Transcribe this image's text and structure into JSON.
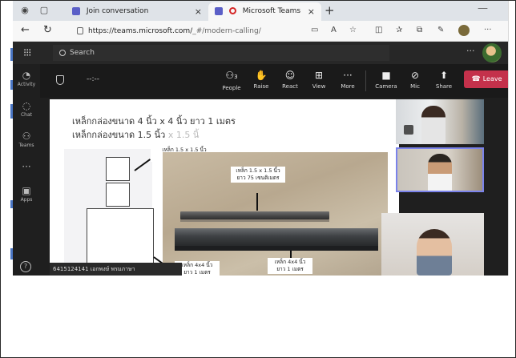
{
  "browser": {
    "tabs": [
      {
        "label": "Join conversation",
        "active": false
      },
      {
        "label": "Microsoft Teams",
        "active": true
      }
    ],
    "new_tab_glyph": "+",
    "close_glyph": "×",
    "minimize_glyph": "—",
    "url_base": "https://teams.microsoft.com/",
    "url_path": "_#/modern-calling/"
  },
  "teams": {
    "search_placeholder": "Search",
    "more_glyph": "···",
    "rail": [
      {
        "label": "Activity",
        "icon": "bell-icon"
      },
      {
        "label": "Chat",
        "icon": "chat-icon"
      },
      {
        "label": "Teams",
        "icon": "teams-icon"
      },
      {
        "label": "",
        "icon": "more-icon"
      },
      {
        "label": "Apps",
        "icon": "apps-icon"
      }
    ],
    "meeting": {
      "timer": "--:--",
      "people_count": "3",
      "buttons": [
        "People",
        "Raise",
        "React",
        "View",
        "More",
        "Camera",
        "Mic",
        "Share"
      ],
      "leave_label": "Leave"
    },
    "shared_content": {
      "line1": "เหล็กกล่องขนาด 4 นิ้ว x 4 นิ้ว ยาว 1 เมตร",
      "line2_main": "เหล็กกล่องขนาด 1.5 นิ้ว",
      "line2_faded": "x 1.5 นิ้",
      "label_small_left": [
        "เหล็ก 1.5 x 1.5 นิ้ว",
        "ยาว 75 เซนติเมตร"
      ],
      "label_small_photo": [
        "เหล็ก 1.5 x 1.5 นิ้ว",
        "ยาว 75 เซนติเมตร"
      ],
      "label_big_left": [
        "เหล็ก 4x4 นิ้ว",
        "ยาว 1 เมตร"
      ],
      "label_big_photo": [
        "เหล็ก 4x4 นิ้ว",
        "ยาว 1 เมตร"
      ]
    },
    "participant_name": "6415124141 เอกพงษ์ พรมภาษา"
  },
  "colors": {
    "leave": "#c4314b",
    "active_speaker": "#7b83eb",
    "teams_bg": "#1f1f1f"
  }
}
